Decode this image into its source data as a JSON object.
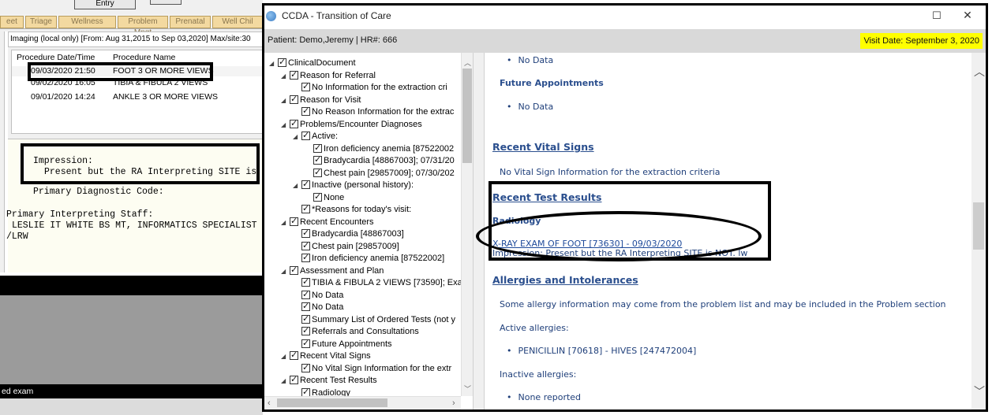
{
  "left_app": {
    "entry_label": "Entry",
    "tabs": [
      "eet",
      "Triage",
      "Wellness",
      "Problem Mngt",
      "Prenatal",
      "Well Chil"
    ],
    "imaging_header": "Imaging (local only) [From: Aug 31,2015 to Sep 03,2020] Max/site:30",
    "columns": [
      "Procedure Date/Time",
      "Procedure Name"
    ],
    "procedures": [
      {
        "date": "09/03/2020 21:50",
        "name": "FOOT 3 OR MORE VIEWS"
      },
      {
        "date": "09/02/2020 16:05",
        "name": "TIBIA & FIBULA 2 VIEWS"
      },
      {
        "date": "09/01/2020 14:24",
        "name": "ANKLE 3 OR MORE VIEWS"
      }
    ],
    "report": {
      "impression_label": "Impression:",
      "impression_text": "Present but the RA Interpreting SITE is NO",
      "diag_code": "Primary Diagnostic Code:",
      "staff_label": "Primary Interpreting Staff:",
      "staff_name": "LESLIE IT WHITE BS MT, INFORMATICS SPECIALIST",
      "staff_initials": "/LRW"
    },
    "status_text": "ed exam"
  },
  "ccda": {
    "title": "CCDA - Transition of Care",
    "maximize": "☐",
    "close": "✕",
    "patient": "Patient: Demo,Jeremy | HR#: 666",
    "visit_date": "Visit Date: September 3, 2020",
    "tree": [
      {
        "text": "ClinicalDocument",
        "indent": 0,
        "arrow": true
      },
      {
        "text": "Reason for Referral",
        "indent": 1,
        "arrow": true
      },
      {
        "text": "No  Information for the extraction cri",
        "indent": 2,
        "arrow": false
      },
      {
        "text": "Reason for Visit",
        "indent": 1,
        "arrow": true
      },
      {
        "text": "No Reason Information for the extrac",
        "indent": 2,
        "arrow": false
      },
      {
        "text": "Problems/Encounter Diagnoses",
        "indent": 1,
        "arrow": true
      },
      {
        "text": "Active:",
        "indent": 2,
        "arrow": true
      },
      {
        "text": "Iron deficiency anemia [87522002",
        "indent": 3,
        "arrow": false
      },
      {
        "text": "Bradycardia [48867003]; 07/31/20",
        "indent": 3,
        "arrow": false
      },
      {
        "text": "Chest pain [29857009]; 07/30/202",
        "indent": 3,
        "arrow": false
      },
      {
        "text": "Inactive (personal history):",
        "indent": 2,
        "arrow": true
      },
      {
        "text": "None",
        "indent": 3,
        "arrow": false
      },
      {
        "text": "*Reasons for today's visit:",
        "indent": 2,
        "arrow": false
      },
      {
        "text": "Recent Encounters",
        "indent": 1,
        "arrow": true
      },
      {
        "text": "Bradycardia [48867003]",
        "indent": 2,
        "arrow": false
      },
      {
        "text": "Chest pain [29857009]",
        "indent": 2,
        "arrow": false
      },
      {
        "text": "Iron deficiency anemia [87522002]",
        "indent": 2,
        "arrow": false
      },
      {
        "text": "Assessment and Plan",
        "indent": 1,
        "arrow": true
      },
      {
        "text": "TIBIA & FIBULA 2 VIEWS [73590]; Exa",
        "indent": 2,
        "arrow": false
      },
      {
        "text": "No Data",
        "indent": 2,
        "arrow": false
      },
      {
        "text": "No Data",
        "indent": 2,
        "arrow": false
      },
      {
        "text": "Summary List of Ordered Tests (not y",
        "indent": 2,
        "arrow": false
      },
      {
        "text": "Referrals and Consultations",
        "indent": 2,
        "arrow": false
      },
      {
        "text": "Future Appointments",
        "indent": 2,
        "arrow": false
      },
      {
        "text": "Recent Vital Signs",
        "indent": 1,
        "arrow": true
      },
      {
        "text": "No Vital Sign Information for the extr",
        "indent": 2,
        "arrow": false
      },
      {
        "text": "Recent Test Results",
        "indent": 1,
        "arrow": true
      },
      {
        "text": "Radiology",
        "indent": 2,
        "arrow": false
      }
    ],
    "document": {
      "no_data_top": "No Data",
      "future_appointments_heading": "Future Appointments",
      "future_appointments_item": "No Data",
      "vital_signs_heading": "Recent Vital Signs",
      "vital_signs_text": "No Vital Sign Information for the extraction criteria",
      "test_results_heading": "Recent Test Results",
      "radiology_heading": "Radiology",
      "radiology_link": "X-RAY EXAM OF FOOT [73630] - 09/03/2020",
      "radiology_impression": "Impression: Present but the RA Interpreting SITE is NOT. lw",
      "allergies_heading": "Allergies and Intolerances",
      "allergies_note": "Some allergy information may come from the problem list and may be included in the Problem section",
      "active_allergies_label": "Active allergies:",
      "active_allergy_item": "PENICILLIN [70618] - HIVES [247472004]",
      "inactive_allergies_label": "Inactive allergies:",
      "inactive_allergy_item": "None reported"
    }
  }
}
